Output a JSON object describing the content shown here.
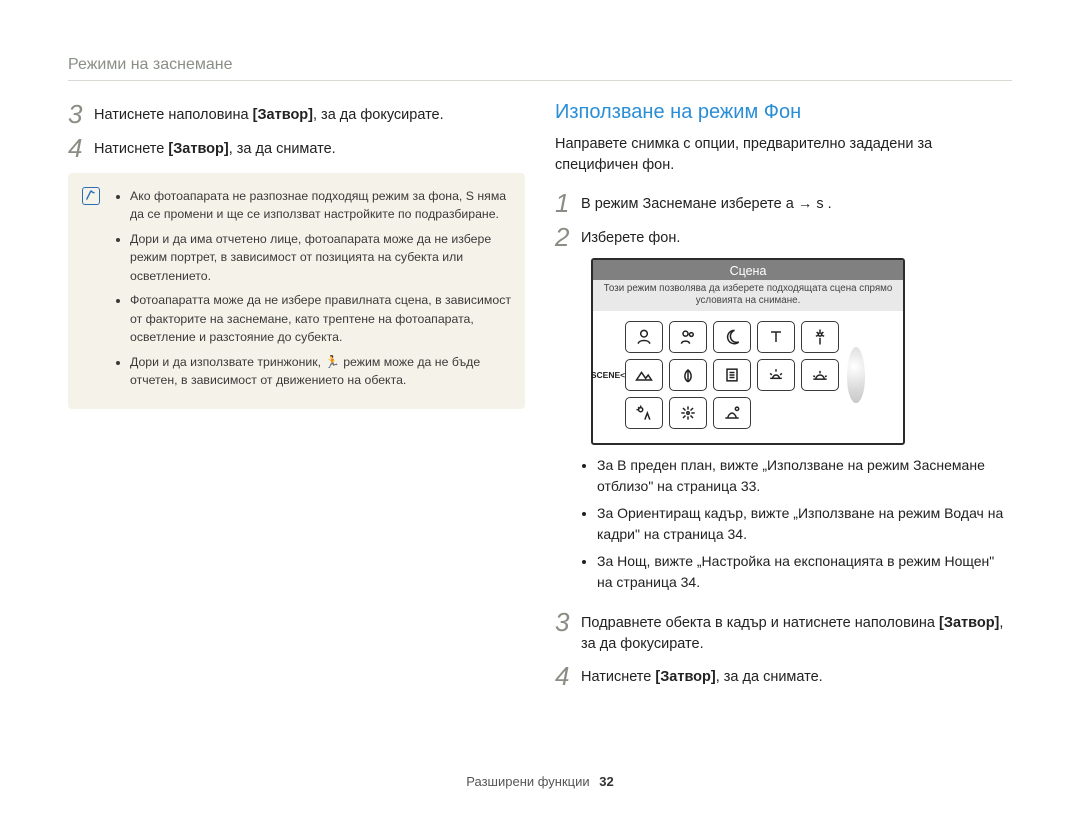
{
  "header": {
    "title": "Режими на заснемане"
  },
  "left": {
    "steps": [
      {
        "num": "3",
        "pre": "Натиснете наполовина ",
        "bold": "[Затвор]",
        "post": ", за да фокусирате."
      },
      {
        "num": "4",
        "pre": "Натиснете ",
        "bold": "[Затвор]",
        "post": ", за да снимате."
      }
    ],
    "note": {
      "items": [
        "Ако фотоапарата не разпознае подходящ режим за фона, S    няма да се промени и ще се използват настройките по подразбиране.",
        "Дори и да има отчетено лице, фотоапарата може да не избере режим портрет, в зависимост от позицията на субекта или осветлението.",
        "Фотоапаратта може да не избере правилната сцена, в зависимост от факторите на заснемане, като трептене на фотоапарата, осветление и разстояние до субекта.",
        "Дори и да използвате тринжоник, 🏃 режим може да не бъде отчетен, в зависимост от движението на обекта."
      ]
    }
  },
  "right": {
    "title": "Използване на режим Фон",
    "intro": "Направете снимка с опции, предварително зададени за специфичен фон.",
    "steps": [
      {
        "num": "1",
        "text": "В режим Заснемане изберете a     → s      ."
      },
      {
        "num": "2",
        "text": "Изберете фон."
      }
    ],
    "screenshot": {
      "title": "Сцена",
      "subtitle": "Този режим позволява да изберете подходящата сцена спрямо условията на снимане.",
      "left_label": "SCENE<",
      "icons": [
        "portrait-icon",
        "children-icon",
        "night-icon",
        "text-icon",
        "flower-icon",
        "landscape-icon",
        "macro-icon",
        "guide-icon",
        "sunset-icon",
        "dawn-icon",
        "backlight-icon",
        "fireworks-icon",
        "beach-icon",
        "",
        ""
      ]
    },
    "sub_bullets": [
      "За В преден план, вижте „Използване на режим Заснемане отблизо\" на страница 33.",
      "За Ориентиращ кадър, вижте „Използване на режим Водач на кадри\" на страница 34.",
      "За Нощ, вижте „Настройка на експонацията в режим Нощен\" на страница 34."
    ],
    "steps2": [
      {
        "num": "3",
        "pre": "Подравнете обекта в кадър и натиснете наполовина ",
        "bold": "[Затвор]",
        "post": ", за да фокусирате."
      },
      {
        "num": "4",
        "pre": "Натиснете ",
        "bold": "[Затвор]",
        "post": ", за да снимате."
      }
    ]
  },
  "footer": {
    "label": "Разширени функции",
    "page": "32"
  }
}
